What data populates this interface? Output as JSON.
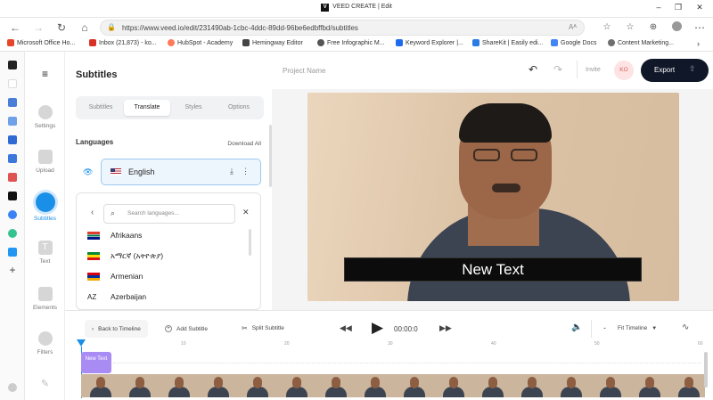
{
  "window": {
    "title": "VEED CREATE | Edit",
    "app_logo_letter": "V"
  },
  "browser": {
    "url": "https://www.veed.io/edit/231490ab-1cbc-4ddc-89dd-96be6edbffbd/subtitles"
  },
  "bookmarks": [
    {
      "label": "Microsoft Office Ho...",
      "color": "#e8462b"
    },
    {
      "label": "Inbox (21,873) - ko...",
      "color": "#d93025"
    },
    {
      "label": "HubSpot - Academy",
      "color": "#ff7a59"
    },
    {
      "label": "Hemingway Editor",
      "color": "#444444"
    },
    {
      "label": "Free Infographic M...",
      "color": "#555555"
    },
    {
      "label": "Keyword Explorer |...",
      "color": "#1d6cf0"
    },
    {
      "label": "ShareKit | Easily edi...",
      "color": "#2a7be4"
    },
    {
      "label": "Google Docs",
      "color": "#4285f4"
    },
    {
      "label": "Content Marketing...",
      "color": "#6f6f6f"
    }
  ],
  "tools": [
    {
      "label": "Settings",
      "active": false
    },
    {
      "label": "Upload",
      "active": false
    },
    {
      "label": "Subtitles",
      "active": true
    },
    {
      "label": "Text",
      "active": false
    },
    {
      "label": "Elements",
      "active": false
    },
    {
      "label": "Filters",
      "active": false
    }
  ],
  "panel": {
    "title": "Subtitles",
    "tabs": [
      "Subtitles",
      "Translate",
      "Styles",
      "Options"
    ],
    "active_tab": "Translate",
    "languages_label": "Languages",
    "download_all": "Download All",
    "selected_language": "English",
    "search_placeholder": "Search languages...",
    "languages": [
      {
        "name": "Afrikaans",
        "flag": "za"
      },
      {
        "name": "አማርኛ (አትዮጵያ)",
        "flag": "et"
      },
      {
        "name": "Armenian",
        "flag": "am"
      },
      {
        "name": "Azerbaijan",
        "flag": "az",
        "code": "AZ"
      }
    ]
  },
  "appbar": {
    "project_name_placeholder": "Project Name",
    "invite": "Invite",
    "avatar_initials": "KO",
    "export": "Export"
  },
  "video": {
    "caption": "New Text"
  },
  "timeline": {
    "back": "Back to Timeline",
    "add_subtitle": "Add Subtitle",
    "split_subtitle": "Split Subtitle",
    "time": "00:00:0",
    "fit": "Fit Timeline",
    "ruler_ticks": [
      "10",
      "20",
      "30",
      "40",
      "50",
      "60"
    ],
    "subtitle_clip": "New Text"
  },
  "colors": {
    "accent": "#1a8fe8",
    "export_bg": "#101728",
    "clip": "#a98bf4"
  }
}
